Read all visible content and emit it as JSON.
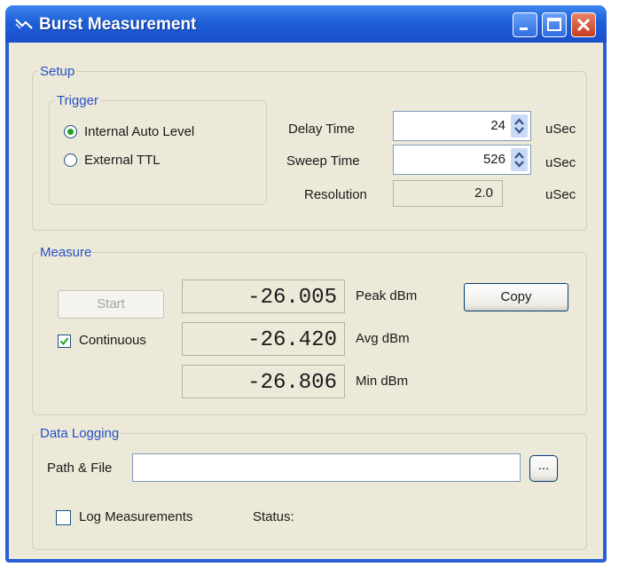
{
  "window": {
    "title": "Burst Measurement"
  },
  "setup": {
    "legend": "Setup",
    "trigger": {
      "legend": "Trigger",
      "options": [
        {
          "label": "Internal Auto Level",
          "selected": true
        },
        {
          "label": "External TTL",
          "selected": false
        }
      ]
    },
    "delay": {
      "label": "Delay Time",
      "value": "24",
      "unit": "uSec"
    },
    "sweep": {
      "label": "Sweep Time",
      "value": "526",
      "unit": "uSec"
    },
    "resolution": {
      "label": "Resolution",
      "value": "2.0",
      "unit": "uSec"
    }
  },
  "measure": {
    "legend": "Measure",
    "start_label": "Start",
    "continuous_label": "Continuous",
    "continuous_checked": true,
    "copy_label": "Copy",
    "readings": [
      {
        "value": "-26.005",
        "label": "Peak dBm"
      },
      {
        "value": "-26.420",
        "label": "Avg dBm"
      },
      {
        "value": "-26.806",
        "label": "Min dBm"
      }
    ]
  },
  "logging": {
    "legend": "Data Logging",
    "path_label": "Path & File",
    "path_value": "",
    "browse_label": "...",
    "log_label": "Log Measurements",
    "log_checked": false,
    "status_label": "Status:"
  }
}
